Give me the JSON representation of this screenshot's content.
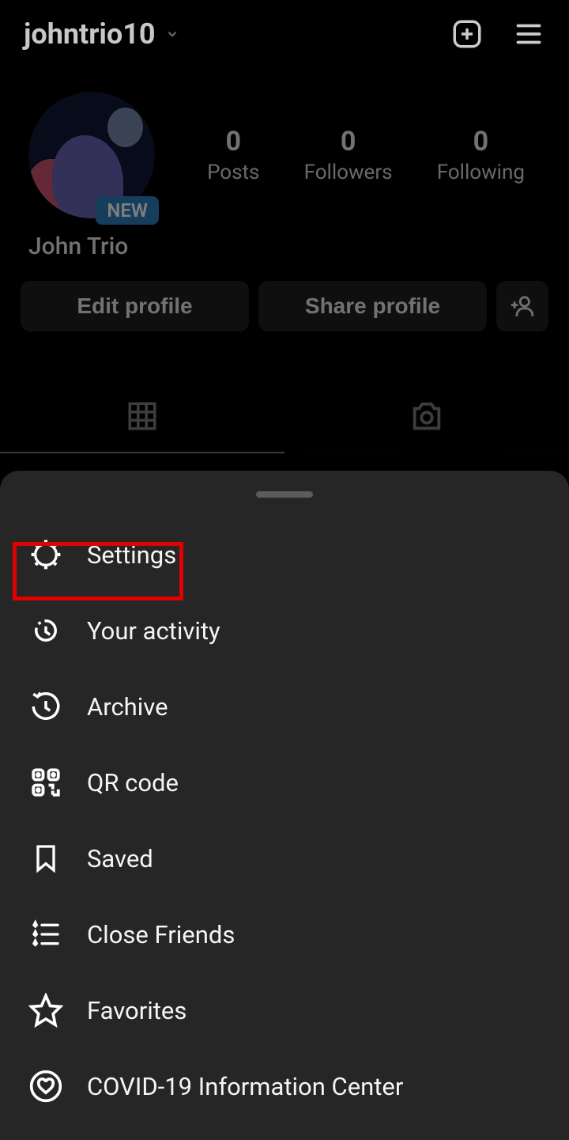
{
  "header": {
    "username": "johntrio10"
  },
  "profile": {
    "new_badge": "NEW",
    "display_name": "John Trio",
    "stats": {
      "posts_count": "0",
      "posts_label": "Posts",
      "followers_count": "0",
      "followers_label": "Followers",
      "following_count": "0",
      "following_label": "Following"
    }
  },
  "actions": {
    "edit_profile": "Edit profile",
    "share_profile": "Share profile"
  },
  "menu": {
    "settings": "Settings",
    "activity": "Your activity",
    "archive": "Archive",
    "qr": "QR code",
    "saved": "Saved",
    "close_friends": "Close Friends",
    "favorites": "Favorites",
    "covid": "COVID-19 Information Center"
  }
}
